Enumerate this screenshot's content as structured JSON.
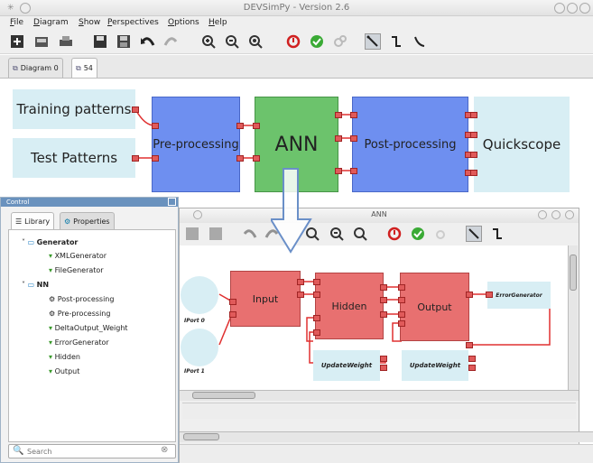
{
  "window": {
    "title": "DEVSimPy - Version 2.6"
  },
  "menu": [
    "File",
    "Diagram",
    "Show",
    "Perspectives",
    "Options",
    "Help"
  ],
  "toolbar": {
    "icons": [
      "new-diagram-icon",
      "open-icon",
      "print-icon",
      "save-icon",
      "save-as-icon",
      "undo-icon",
      "redo-icon",
      "zoom-in-icon",
      "zoom-out-icon",
      "zoom-fit-icon",
      "stop-icon",
      "check-icon",
      "simulate-icon",
      "direct-link-icon",
      "square-link-icon",
      "linear-link-icon"
    ]
  },
  "tabs": [
    {
      "label": "Diagram 0"
    },
    {
      "label": "54"
    }
  ],
  "diagram": {
    "training": "Training patterns",
    "test": "Test Patterns",
    "pre": "Pre-processing",
    "ann": "ANN",
    "post": "Post-processing",
    "quick": "Quickscope"
  },
  "control": {
    "title": "Control",
    "tab_library": "Library",
    "tab_properties": "Properties",
    "search_placeholder": "Search",
    "tree": [
      {
        "label": "Generator",
        "children": [
          "XMLGenerator",
          "FileGenerator"
        ]
      },
      {
        "label": "NN",
        "children": [
          "Post-processing",
          "Pre-processing",
          "DeltaOutput_Weight",
          "ErrorGenerator",
          "Hidden",
          "Output"
        ]
      }
    ]
  },
  "ann": {
    "title": "ANN",
    "iport0": "IPort 0",
    "iport1": "IPort 1",
    "input": "Input",
    "hidden": "Hidden",
    "output": "Output",
    "error": "ErrorGenerator",
    "update1": "UpdateWeight",
    "update2": "UpdateWeight"
  },
  "colors": {
    "blue_block": "#6e8ff0",
    "green_block": "#6cc36c",
    "light_block": "#d8eef4",
    "red_block": "#e87070",
    "port": "#e05a5a",
    "control_title": "#6a92be"
  }
}
